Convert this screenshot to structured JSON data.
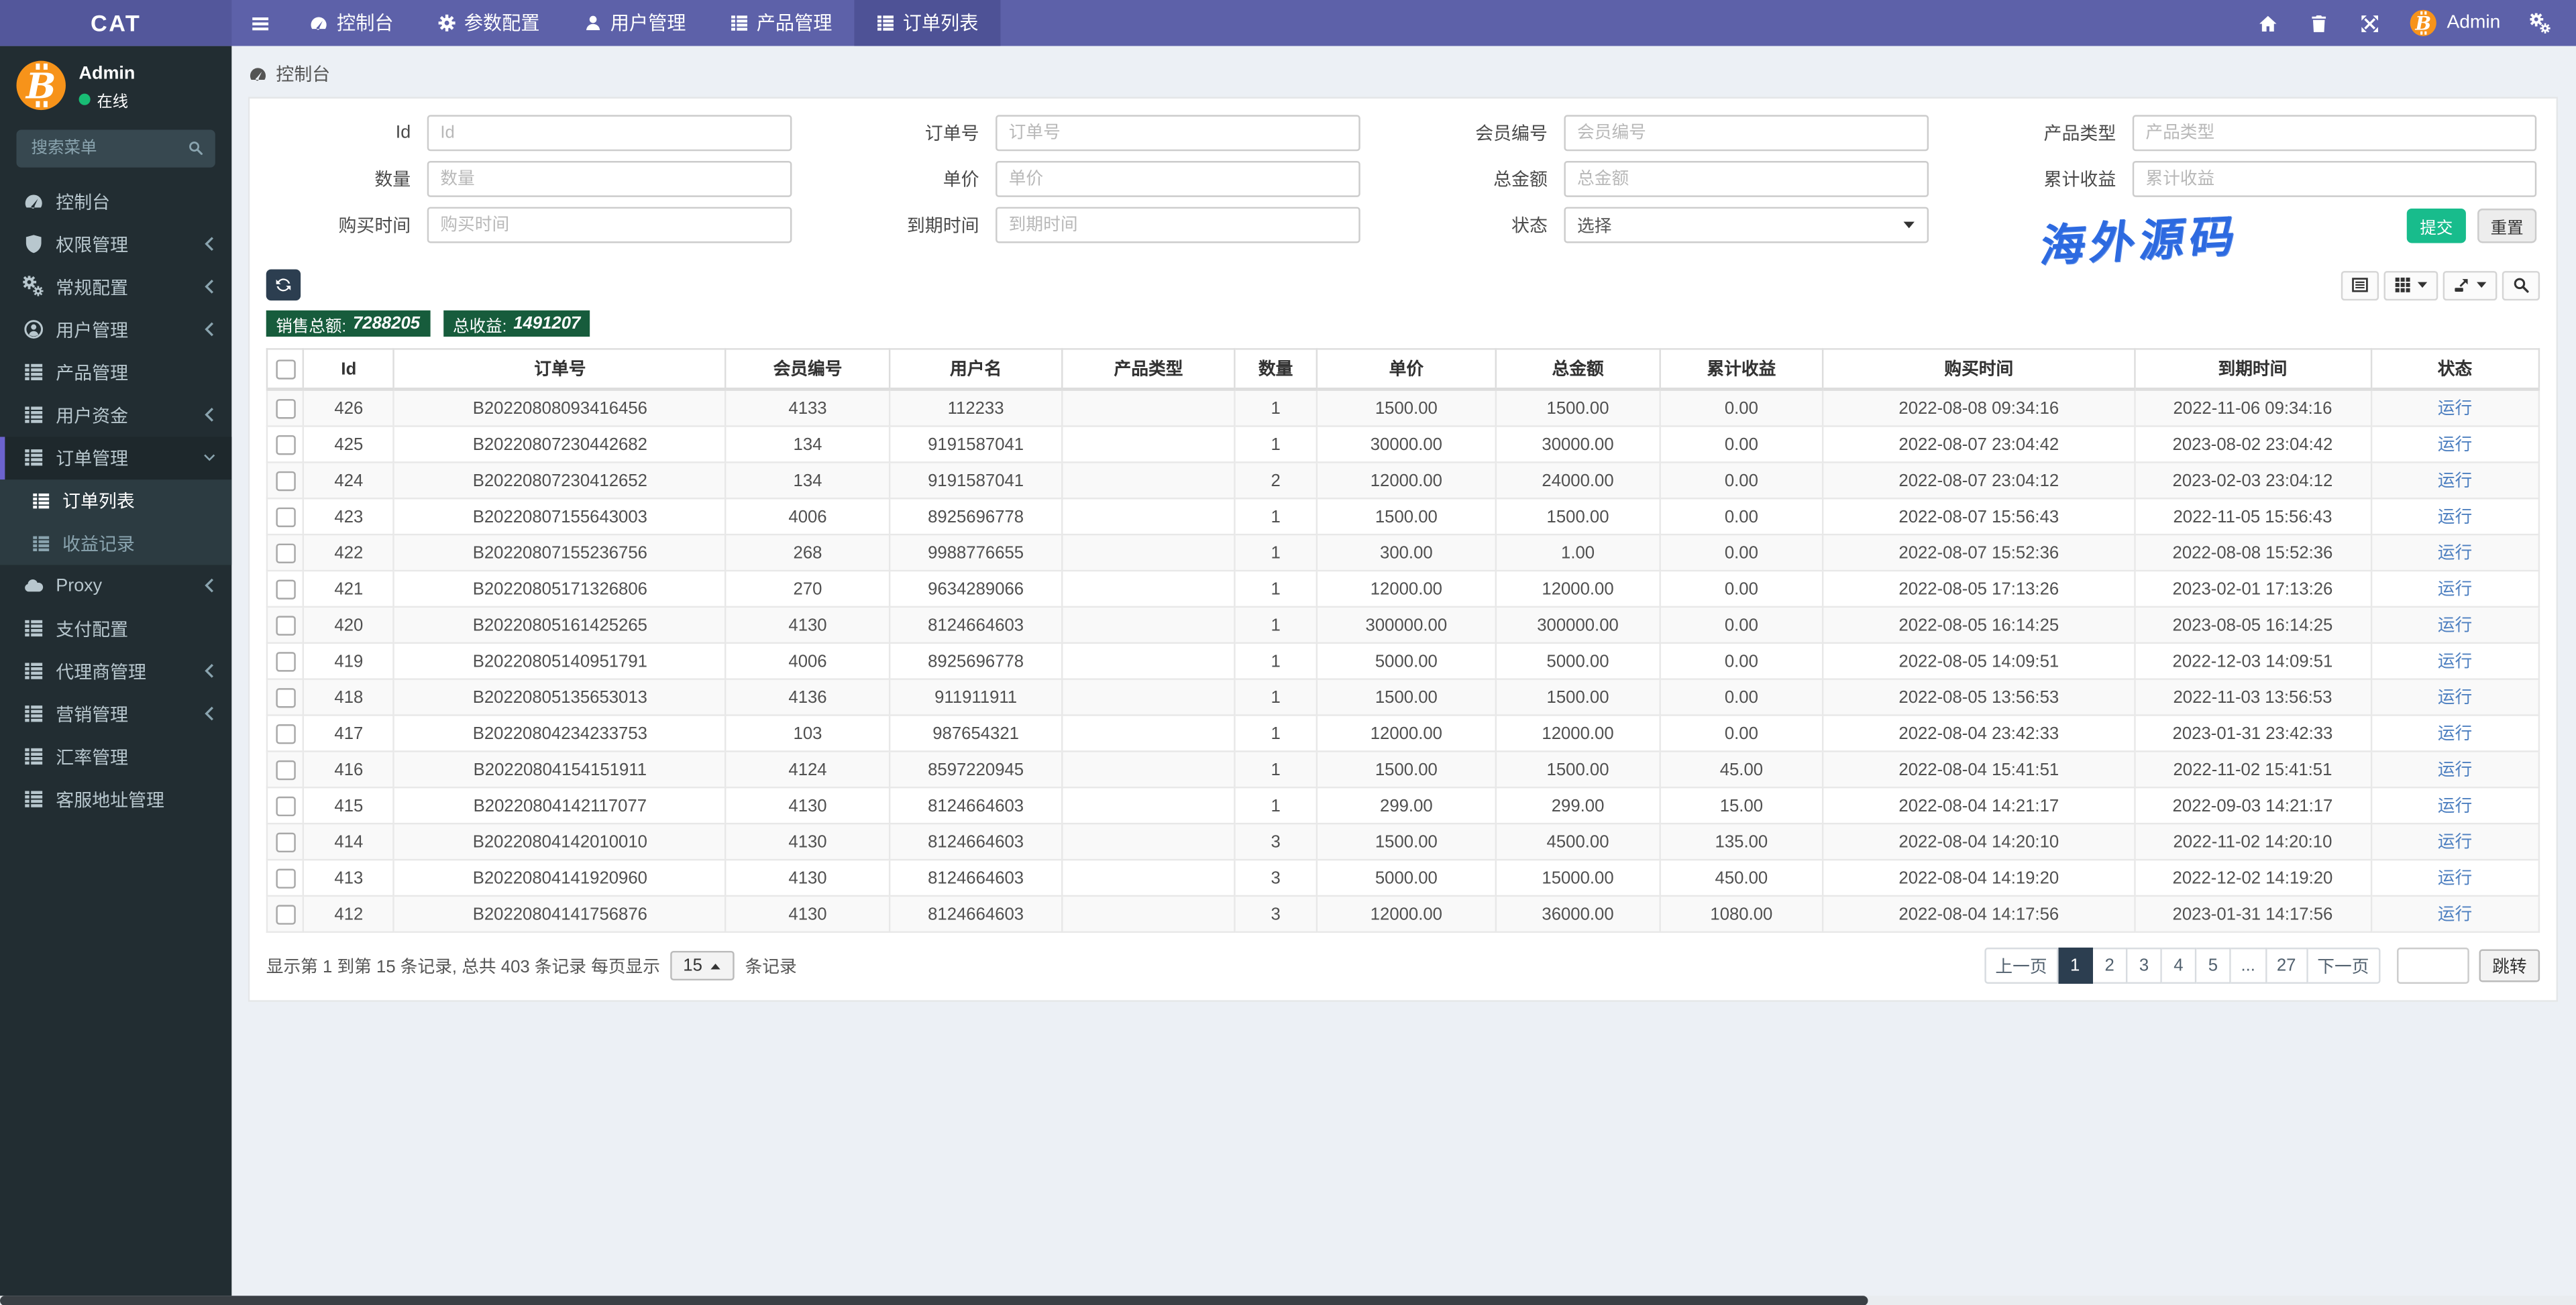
{
  "topbar": {
    "logo": "CAT",
    "menu": [
      {
        "icon": "gauge",
        "label": "控制台",
        "active": false
      },
      {
        "icon": "gear",
        "label": "参数配置",
        "active": false
      },
      {
        "icon": "user",
        "label": "用户管理",
        "active": false
      },
      {
        "icon": "thlist",
        "label": "产品管理",
        "active": false
      },
      {
        "icon": "thlist",
        "label": "订单列表",
        "active": true
      }
    ],
    "right_icons": [
      "home",
      "trash",
      "expand",
      "cogs"
    ],
    "user": "Admin"
  },
  "sidebar": {
    "user": {
      "name": "Admin",
      "status": "在线"
    },
    "search_placeholder": "搜索菜单",
    "items": [
      {
        "icon": "gauge",
        "label": "控制台",
        "arrow": null
      },
      {
        "icon": "shield",
        "label": "权限管理",
        "arrow": "left"
      },
      {
        "icon": "cogs",
        "label": "常规配置",
        "arrow": "left"
      },
      {
        "icon": "usercircle",
        "label": "用户管理",
        "arrow": "left"
      },
      {
        "icon": "thlist",
        "label": "产品管理",
        "arrow": null
      },
      {
        "icon": "thlist",
        "label": "用户资金",
        "arrow": "left"
      },
      {
        "icon": "thlist",
        "label": "订单管理",
        "arrow": "down",
        "active": true,
        "children": [
          {
            "icon": "thlist",
            "label": "订单列表",
            "active": true
          },
          {
            "icon": "thlist",
            "label": "收益记录",
            "active": false
          }
        ]
      },
      {
        "icon": "cloud",
        "label": "Proxy",
        "arrow": "left"
      },
      {
        "icon": "thlist",
        "label": "支付配置",
        "arrow": null
      },
      {
        "icon": "thlist",
        "label": "代理商管理",
        "arrow": "left"
      },
      {
        "icon": "thlist",
        "label": "营销管理",
        "arrow": "left"
      },
      {
        "icon": "thlist",
        "label": "汇率管理",
        "arrow": null
      },
      {
        "icon": "thlist",
        "label": "客服地址管理",
        "arrow": null
      }
    ]
  },
  "breadcrumb": {
    "icon": "gauge",
    "label": "控制台"
  },
  "filters": {
    "rows": [
      [
        {
          "label": "Id",
          "placeholder": "Id"
        },
        {
          "label": "订单号",
          "placeholder": "订单号"
        },
        {
          "label": "会员编号",
          "placeholder": "会员编号"
        },
        {
          "label": "产品类型",
          "placeholder": "产品类型"
        }
      ],
      [
        {
          "label": "数量",
          "placeholder": "数量"
        },
        {
          "label": "单价",
          "placeholder": "单价"
        },
        {
          "label": "总金额",
          "placeholder": "总金额"
        },
        {
          "label": "累计收益",
          "placeholder": "累计收益"
        }
      ],
      [
        {
          "label": "购买时间",
          "placeholder": "购买时间"
        },
        {
          "label": "到期时间",
          "placeholder": "到期时间"
        },
        {
          "label": "状态",
          "type": "select",
          "value": "选择"
        },
        {
          "type": "buttons"
        }
      ]
    ],
    "submit_label": "提交",
    "reset_label": "重置"
  },
  "stats": {
    "sales_label": "销售总额:",
    "sales_value": "7288205",
    "profit_label": "总收益:",
    "profit_value": "1491207"
  },
  "toolbar": {
    "buttons": [
      "detail-view",
      "columns",
      "export",
      "search"
    ]
  },
  "watermark": "海外源码",
  "table": {
    "columns": [
      "Id",
      "订单号",
      "会员编号",
      "用户名",
      "产品类型",
      "数量",
      "单价",
      "总金额",
      "累计收益",
      "购买时间",
      "到期时间",
      "状态"
    ],
    "rows": [
      [
        "426",
        "B20220808093416456",
        "4133",
        "112233",
        "",
        "1",
        "1500.00",
        "1500.00",
        "0.00",
        "2022-08-08 09:34:16",
        "2022-11-06 09:34:16",
        "运行"
      ],
      [
        "425",
        "B20220807230442682",
        "134",
        "9191587041",
        "",
        "1",
        "30000.00",
        "30000.00",
        "0.00",
        "2022-08-07 23:04:42",
        "2023-08-02 23:04:42",
        "运行"
      ],
      [
        "424",
        "B20220807230412652",
        "134",
        "9191587041",
        "",
        "2",
        "12000.00",
        "24000.00",
        "0.00",
        "2022-08-07 23:04:12",
        "2023-02-03 23:04:12",
        "运行"
      ],
      [
        "423",
        "B20220807155643003",
        "4006",
        "8925696778",
        "",
        "1",
        "1500.00",
        "1500.00",
        "0.00",
        "2022-08-07 15:56:43",
        "2022-11-05 15:56:43",
        "运行"
      ],
      [
        "422",
        "B20220807155236756",
        "268",
        "9988776655",
        "",
        "1",
        "300.00",
        "1.00",
        "0.00",
        "2022-08-07 15:52:36",
        "2022-08-08 15:52:36",
        "运行"
      ],
      [
        "421",
        "B20220805171326806",
        "270",
        "9634289066",
        "",
        "1",
        "12000.00",
        "12000.00",
        "0.00",
        "2022-08-05 17:13:26",
        "2023-02-01 17:13:26",
        "运行"
      ],
      [
        "420",
        "B20220805161425265",
        "4130",
        "8124664603",
        "",
        "1",
        "300000.00",
        "300000.00",
        "0.00",
        "2022-08-05 16:14:25",
        "2023-08-05 16:14:25",
        "运行"
      ],
      [
        "419",
        "B20220805140951791",
        "4006",
        "8925696778",
        "",
        "1",
        "5000.00",
        "5000.00",
        "0.00",
        "2022-08-05 14:09:51",
        "2022-12-03 14:09:51",
        "运行"
      ],
      [
        "418",
        "B20220805135653013",
        "4136",
        "911911911",
        "",
        "1",
        "1500.00",
        "1500.00",
        "0.00",
        "2022-08-05 13:56:53",
        "2022-11-03 13:56:53",
        "运行"
      ],
      [
        "417",
        "B20220804234233753",
        "103",
        "987654321",
        "",
        "1",
        "12000.00",
        "12000.00",
        "0.00",
        "2022-08-04 23:42:33",
        "2023-01-31 23:42:33",
        "运行"
      ],
      [
        "416",
        "B20220804154151911",
        "4124",
        "8597220945",
        "",
        "1",
        "1500.00",
        "1500.00",
        "45.00",
        "2022-08-04 15:41:51",
        "2022-11-02 15:41:51",
        "运行"
      ],
      [
        "415",
        "B20220804142117077",
        "4130",
        "8124664603",
        "",
        "1",
        "299.00",
        "299.00",
        "15.00",
        "2022-08-04 14:21:17",
        "2022-09-03 14:21:17",
        "运行"
      ],
      [
        "414",
        "B20220804142010010",
        "4130",
        "8124664603",
        "",
        "3",
        "1500.00",
        "4500.00",
        "135.00",
        "2022-08-04 14:20:10",
        "2022-11-02 14:20:10",
        "运行"
      ],
      [
        "413",
        "B20220804141920960",
        "4130",
        "8124664603",
        "",
        "3",
        "5000.00",
        "15000.00",
        "450.00",
        "2022-08-04 14:19:20",
        "2022-12-02 14:19:20",
        "运行"
      ],
      [
        "412",
        "B20220804141756876",
        "4130",
        "8124664603",
        "",
        "3",
        "12000.00",
        "36000.00",
        "1080.00",
        "2022-08-04 14:17:56",
        "2023-01-31 14:17:56",
        "运行"
      ]
    ]
  },
  "footer": {
    "info_prefix": "显示第 1 到第 15 条记录, 总共 403 条记录 每页显示",
    "page_size": "15",
    "info_suffix": "条记录",
    "pages": [
      "上一页",
      "1",
      "2",
      "3",
      "4",
      "5",
      "...",
      "27",
      "下一页"
    ],
    "active_page": "1",
    "jump_value": "",
    "jump_label": "跳转"
  },
  "colors": {
    "topbar": "#5d61a9",
    "topbar_active": "#4e5296",
    "sidebar": "#222d32",
    "submenu": "#2c3b41",
    "submit_button": "#18bc8c",
    "badge_green": "#175c3c",
    "refresh_navy": "#2c3e50",
    "pagination_active": "#2c3e50",
    "status_link": "#4d7fc0",
    "watermark_blue": "#2d6ae0",
    "avatar_orange": "#f7931a"
  }
}
